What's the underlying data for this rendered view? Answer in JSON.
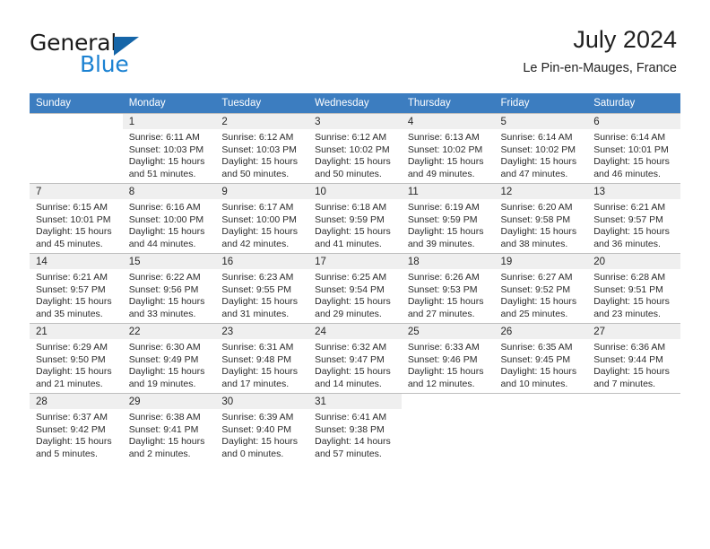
{
  "brand": {
    "name_top": "General",
    "name_bottom": "Blue",
    "triangle_color": "#1565a8",
    "blue_color": "#1c82d2"
  },
  "header": {
    "month_year": "July 2024",
    "location": "Le Pin-en-Mauges, France"
  },
  "theme": {
    "header_row_bg": "#3c7dc0",
    "header_row_text": "#ffffff",
    "daynum_shade": "#efefef",
    "row_shade": "#f5f5f5",
    "grid_line": "#bfbfbf"
  },
  "calendar": {
    "weekday_headers": [
      "Sunday",
      "Monday",
      "Tuesday",
      "Wednesday",
      "Thursday",
      "Friday",
      "Saturday"
    ],
    "labels": {
      "sunrise": "Sunrise:",
      "sunset": "Sunset:",
      "daylight": "Daylight:"
    },
    "weeks": [
      [
        {
          "day": "",
          "line1": "",
          "line2": "",
          "line3": "",
          "line4": ""
        },
        {
          "day": "1",
          "line1": "Sunrise: 6:11 AM",
          "line2": "Sunset: 10:03 PM",
          "line3": "Daylight: 15 hours",
          "line4": "and 51 minutes."
        },
        {
          "day": "2",
          "line1": "Sunrise: 6:12 AM",
          "line2": "Sunset: 10:03 PM",
          "line3": "Daylight: 15 hours",
          "line4": "and 50 minutes."
        },
        {
          "day": "3",
          "line1": "Sunrise: 6:12 AM",
          "line2": "Sunset: 10:02 PM",
          "line3": "Daylight: 15 hours",
          "line4": "and 50 minutes."
        },
        {
          "day": "4",
          "line1": "Sunrise: 6:13 AM",
          "line2": "Sunset: 10:02 PM",
          "line3": "Daylight: 15 hours",
          "line4": "and 49 minutes."
        },
        {
          "day": "5",
          "line1": "Sunrise: 6:14 AM",
          "line2": "Sunset: 10:02 PM",
          "line3": "Daylight: 15 hours",
          "line4": "and 47 minutes."
        },
        {
          "day": "6",
          "line1": "Sunrise: 6:14 AM",
          "line2": "Sunset: 10:01 PM",
          "line3": "Daylight: 15 hours",
          "line4": "and 46 minutes."
        }
      ],
      [
        {
          "day": "7",
          "line1": "Sunrise: 6:15 AM",
          "line2": "Sunset: 10:01 PM",
          "line3": "Daylight: 15 hours",
          "line4": "and 45 minutes."
        },
        {
          "day": "8",
          "line1": "Sunrise: 6:16 AM",
          "line2": "Sunset: 10:00 PM",
          "line3": "Daylight: 15 hours",
          "line4": "and 44 minutes."
        },
        {
          "day": "9",
          "line1": "Sunrise: 6:17 AM",
          "line2": "Sunset: 10:00 PM",
          "line3": "Daylight: 15 hours",
          "line4": "and 42 minutes."
        },
        {
          "day": "10",
          "line1": "Sunrise: 6:18 AM",
          "line2": "Sunset: 9:59 PM",
          "line3": "Daylight: 15 hours",
          "line4": "and 41 minutes."
        },
        {
          "day": "11",
          "line1": "Sunrise: 6:19 AM",
          "line2": "Sunset: 9:59 PM",
          "line3": "Daylight: 15 hours",
          "line4": "and 39 minutes."
        },
        {
          "day": "12",
          "line1": "Sunrise: 6:20 AM",
          "line2": "Sunset: 9:58 PM",
          "line3": "Daylight: 15 hours",
          "line4": "and 38 minutes."
        },
        {
          "day": "13",
          "line1": "Sunrise: 6:21 AM",
          "line2": "Sunset: 9:57 PM",
          "line3": "Daylight: 15 hours",
          "line4": "and 36 minutes."
        }
      ],
      [
        {
          "day": "14",
          "line1": "Sunrise: 6:21 AM",
          "line2": "Sunset: 9:57 PM",
          "line3": "Daylight: 15 hours",
          "line4": "and 35 minutes."
        },
        {
          "day": "15",
          "line1": "Sunrise: 6:22 AM",
          "line2": "Sunset: 9:56 PM",
          "line3": "Daylight: 15 hours",
          "line4": "and 33 minutes."
        },
        {
          "day": "16",
          "line1": "Sunrise: 6:23 AM",
          "line2": "Sunset: 9:55 PM",
          "line3": "Daylight: 15 hours",
          "line4": "and 31 minutes."
        },
        {
          "day": "17",
          "line1": "Sunrise: 6:25 AM",
          "line2": "Sunset: 9:54 PM",
          "line3": "Daylight: 15 hours",
          "line4": "and 29 minutes."
        },
        {
          "day": "18",
          "line1": "Sunrise: 6:26 AM",
          "line2": "Sunset: 9:53 PM",
          "line3": "Daylight: 15 hours",
          "line4": "and 27 minutes."
        },
        {
          "day": "19",
          "line1": "Sunrise: 6:27 AM",
          "line2": "Sunset: 9:52 PM",
          "line3": "Daylight: 15 hours",
          "line4": "and 25 minutes."
        },
        {
          "day": "20",
          "line1": "Sunrise: 6:28 AM",
          "line2": "Sunset: 9:51 PM",
          "line3": "Daylight: 15 hours",
          "line4": "and 23 minutes."
        }
      ],
      [
        {
          "day": "21",
          "line1": "Sunrise: 6:29 AM",
          "line2": "Sunset: 9:50 PM",
          "line3": "Daylight: 15 hours",
          "line4": "and 21 minutes."
        },
        {
          "day": "22",
          "line1": "Sunrise: 6:30 AM",
          "line2": "Sunset: 9:49 PM",
          "line3": "Daylight: 15 hours",
          "line4": "and 19 minutes."
        },
        {
          "day": "23",
          "line1": "Sunrise: 6:31 AM",
          "line2": "Sunset: 9:48 PM",
          "line3": "Daylight: 15 hours",
          "line4": "and 17 minutes."
        },
        {
          "day": "24",
          "line1": "Sunrise: 6:32 AM",
          "line2": "Sunset: 9:47 PM",
          "line3": "Daylight: 15 hours",
          "line4": "and 14 minutes."
        },
        {
          "day": "25",
          "line1": "Sunrise: 6:33 AM",
          "line2": "Sunset: 9:46 PM",
          "line3": "Daylight: 15 hours",
          "line4": "and 12 minutes."
        },
        {
          "day": "26",
          "line1": "Sunrise: 6:35 AM",
          "line2": "Sunset: 9:45 PM",
          "line3": "Daylight: 15 hours",
          "line4": "and 10 minutes."
        },
        {
          "day": "27",
          "line1": "Sunrise: 6:36 AM",
          "line2": "Sunset: 9:44 PM",
          "line3": "Daylight: 15 hours",
          "line4": "and 7 minutes."
        }
      ],
      [
        {
          "day": "28",
          "line1": "Sunrise: 6:37 AM",
          "line2": "Sunset: 9:42 PM",
          "line3": "Daylight: 15 hours",
          "line4": "and 5 minutes."
        },
        {
          "day": "29",
          "line1": "Sunrise: 6:38 AM",
          "line2": "Sunset: 9:41 PM",
          "line3": "Daylight: 15 hours",
          "line4": "and 2 minutes."
        },
        {
          "day": "30",
          "line1": "Sunrise: 6:39 AM",
          "line2": "Sunset: 9:40 PM",
          "line3": "Daylight: 15 hours",
          "line4": "and 0 minutes."
        },
        {
          "day": "31",
          "line1": "Sunrise: 6:41 AM",
          "line2": "Sunset: 9:38 PM",
          "line3": "Daylight: 14 hours",
          "line4": "and 57 minutes."
        },
        {
          "day": "",
          "line1": "",
          "line2": "",
          "line3": "",
          "line4": ""
        },
        {
          "day": "",
          "line1": "",
          "line2": "",
          "line3": "",
          "line4": ""
        },
        {
          "day": "",
          "line1": "",
          "line2": "",
          "line3": "",
          "line4": ""
        }
      ]
    ]
  }
}
